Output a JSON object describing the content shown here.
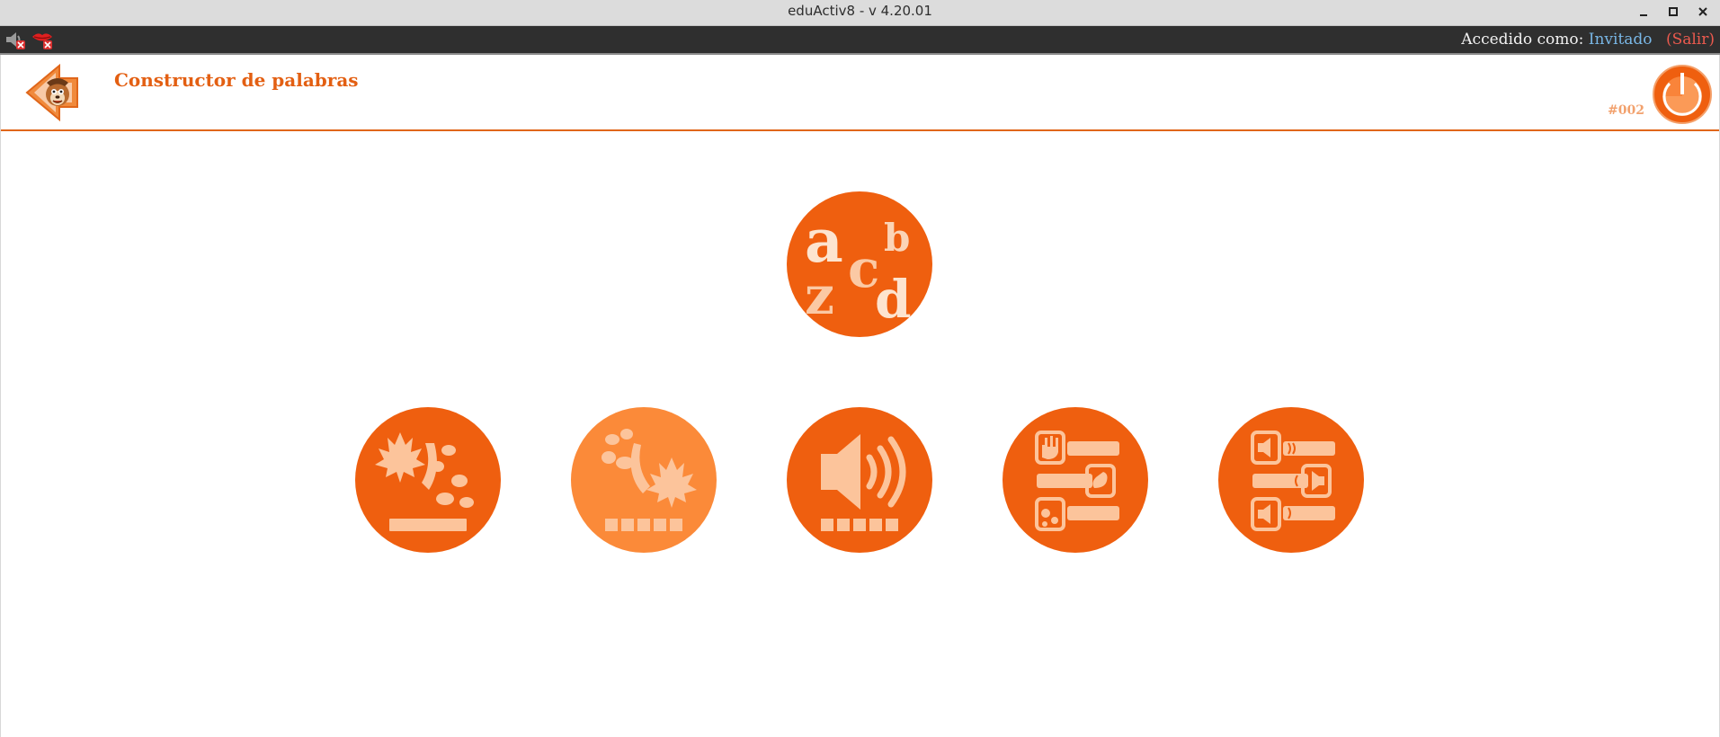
{
  "window": {
    "title": "eduActiv8 - v 4.20.01"
  },
  "session_bar": {
    "sound_icon": "speaker-muted-icon",
    "speech_icon": "lips-muted-icon",
    "logged_in_label": "Accedido como:",
    "user_name": "Invitado",
    "logout_label": "(Salir)"
  },
  "header": {
    "title": "Constructor de palabras",
    "game_code": "#002",
    "back_icon": "back-arrow-mascot-icon",
    "exit_icon": "power-icon"
  },
  "colors": {
    "accent": "#ef5f0f",
    "accent_light": "#fb8a39",
    "glyph_light": "#fcc49b",
    "title_color": "#e35f12",
    "code_color": "#f2a16d",
    "user_link": "#79b7e6",
    "logout_link": "#ec5a4e"
  },
  "category": {
    "icon": "alphabet-letters-icon",
    "letters": [
      "a",
      "c",
      "b",
      "z",
      "d"
    ]
  },
  "activities": [
    {
      "icon": "maple-leaf-word-icon",
      "selected": false
    },
    {
      "icon": "maple-leaf-letters-icon",
      "selected": true
    },
    {
      "icon": "speaker-letters-icon",
      "selected": false
    },
    {
      "icon": "hand-match-bars-icon",
      "selected": false
    },
    {
      "icon": "speaker-match-bars-icon",
      "selected": false
    }
  ]
}
